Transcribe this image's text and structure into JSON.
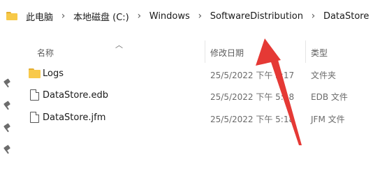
{
  "address_bar": {
    "breadcrumbs": [
      "此电脑",
      "本地磁盘 (C:)",
      "Windows",
      "SoftwareDistribution",
      "DataStore"
    ],
    "separator": "›"
  },
  "columns": {
    "name": "名称",
    "date_modified": "修改日期",
    "type": "类型"
  },
  "files": [
    {
      "name": "Logs",
      "date": "25/5/2022 下午 5:17",
      "type": "文件夹",
      "icon": "folder-icon"
    },
    {
      "name": "DataStore.edb",
      "date": "25/5/2022 下午 5:18",
      "type": "EDB 文件",
      "icon": "file-icon"
    },
    {
      "name": "DataStore.jfm",
      "date": "25/5/2022 下午 5:18",
      "type": "JFM 文件",
      "icon": "file-icon"
    }
  ],
  "annotation": {
    "arrow_color": "#e53935"
  },
  "colors": {
    "folder": "#f8c94a",
    "folder_tab": "#e3ad2f",
    "secondary_text": "#6b6b6b"
  }
}
